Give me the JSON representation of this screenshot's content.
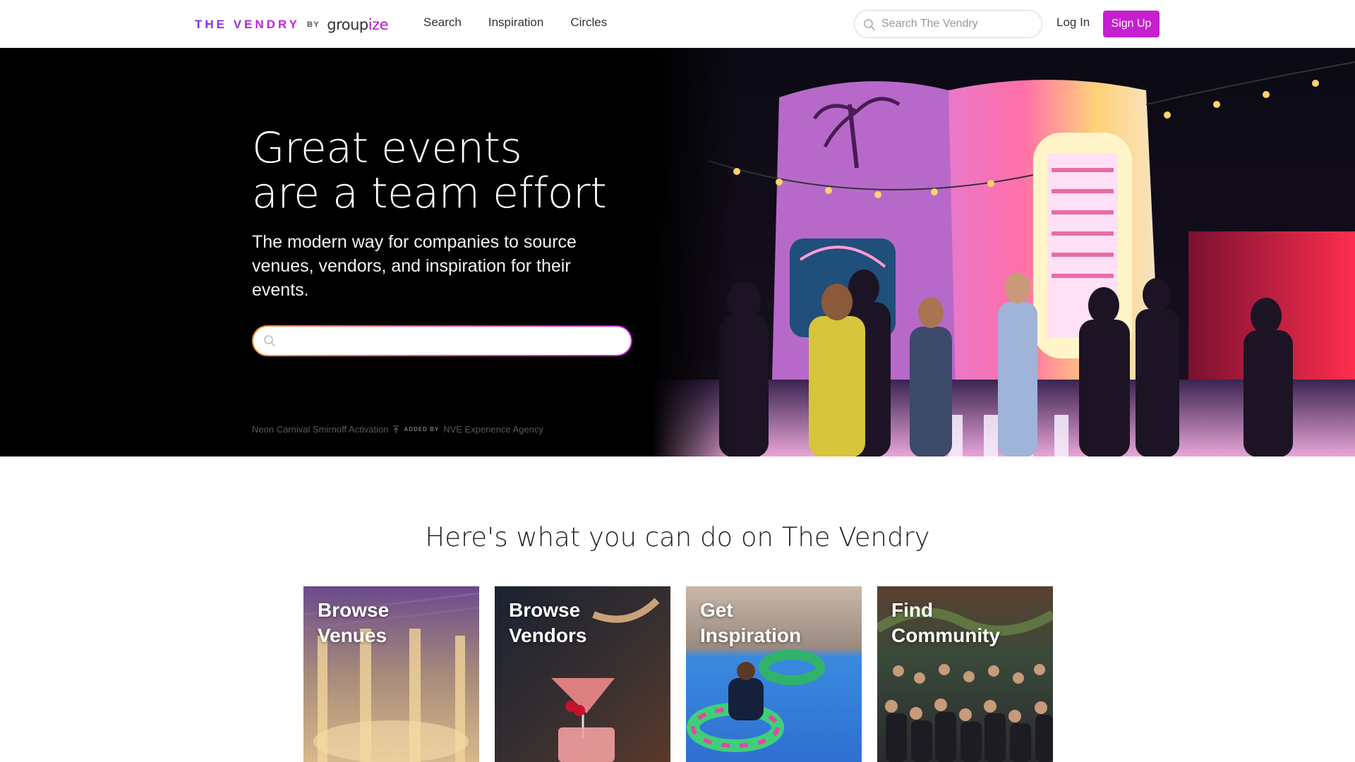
{
  "nav": {
    "logo_main": "THE VENDRY",
    "logo_by": "BY",
    "logo_brand_a": "group",
    "logo_brand_b": "ize",
    "links": [
      "Search",
      "Inspiration",
      "Circles"
    ],
    "search_placeholder": "Search The Vendry",
    "login_label": "Log In",
    "signup_label": "Sign Up",
    "accent_color": "#c51fd0"
  },
  "hero": {
    "title_line1": "Great events",
    "title_line2": "are a team effort",
    "subtitle": "The modern way for companies to source venues, vendors, and inspiration for their events.",
    "search_placeholder": "",
    "credit_title": "Neon Carnival Smirnoff Activation",
    "credit_added_by": "ADDED BY",
    "credit_agency": "NVE Experience Agency",
    "search_icon": "search-icon",
    "credit_icon": "upload-icon"
  },
  "section": {
    "title": "Here's what you can do on The Vendry",
    "cards": [
      {
        "line1": "Browse",
        "line2": "Venues"
      },
      {
        "line1": "Browse",
        "line2": "Vendors"
      },
      {
        "line1": "Get",
        "line2": "Inspiration"
      },
      {
        "line1": "Find",
        "line2": "Community"
      }
    ]
  }
}
